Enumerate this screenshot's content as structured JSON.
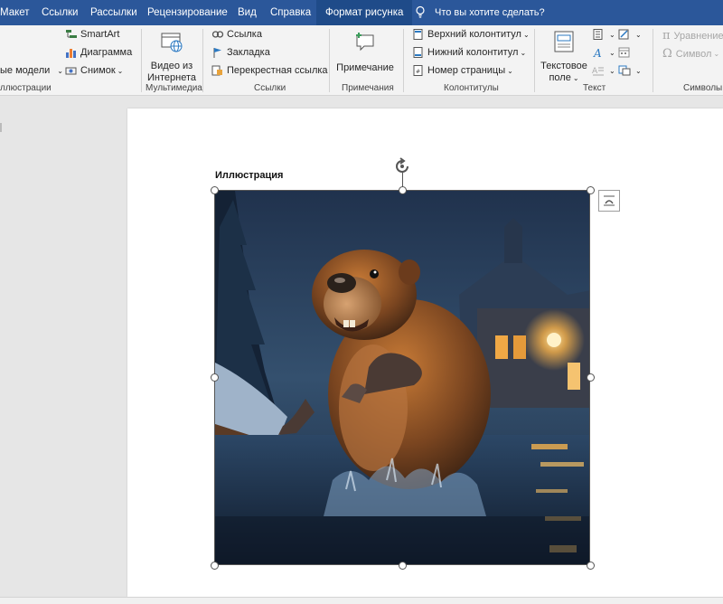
{
  "tabs": {
    "maket": "Макет",
    "ssylki": "Ссылки",
    "rassylki": "Рассылки",
    "recenz": "Рецензирование",
    "vid": "Вид",
    "spravka": "Справка",
    "format": "Формат рисунка"
  },
  "tell_me": "Что вы хотите сделать?",
  "illustrations": {
    "smartart": "SmartArt",
    "diagram": "Диаграмма",
    "models": "ые модели",
    "snimok": "Снимок",
    "label": "ллюстрации"
  },
  "media": {
    "video_line1": "Видео из",
    "video_line2": "Интернета",
    "label": "Мультимедиа"
  },
  "links": {
    "link": "Ссылка",
    "bookmark": "Закладка",
    "crossref": "Перекрестная ссылка",
    "label": "Ссылки"
  },
  "comments": {
    "comment": "Примечание",
    "label": "Примечания"
  },
  "headers": {
    "header": "Верхний колонтитул",
    "footer": "Нижний колонтитул",
    "pagenum": "Номер страницы",
    "label": "Колонтитулы"
  },
  "text": {
    "textbox_line1": "Текстовое",
    "textbox_line2": "поле",
    "label": "Текст"
  },
  "symbols": {
    "equation": "Уравнение",
    "symbol": "Символ",
    "label": "Символы"
  },
  "document": {
    "caption": "Иллюстрация"
  },
  "colors": {
    "accent": "#2b579a",
    "active_tab": "#1f4b89"
  }
}
